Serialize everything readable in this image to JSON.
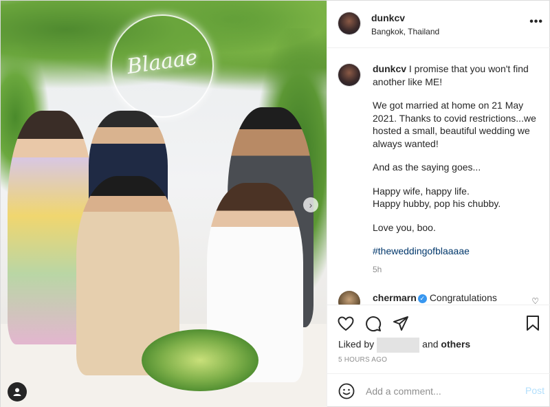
{
  "post": {
    "username": "dunkcv",
    "location": "Bangkok, Thailand",
    "more_icon": "more-horizontal-icon",
    "photo_neon_text": "Blaaae"
  },
  "caption": {
    "username": "dunkcv",
    "line1": "I promise that you won't find another like ME!",
    "para2": "We got married at home on 21 May 2021. Thanks to covid restrictions...we hosted a small, beautiful wedding we always wanted!",
    "para3": "And as the saying goes...",
    "para4a": "Happy wife, happy life.",
    "para4b": "Happy hubby, pop his chubby.",
    "para5": "Love you, boo.",
    "hashtag": "#theweddingofblaaaae",
    "time": "5h"
  },
  "comment": {
    "username": "chermarn",
    "text": "Congratulations"
  },
  "actions": {
    "liked_by_prefix": "Liked by",
    "and": "and",
    "others": "others",
    "timestamp": "5 HOURS AGO"
  },
  "composer": {
    "placeholder": "Add a comment...",
    "post_label": "Post"
  },
  "colors": {
    "link": "#00376b",
    "verified": "#3897f0",
    "post_disabled": "#b2dffc",
    "muted": "#8e8e8e"
  }
}
